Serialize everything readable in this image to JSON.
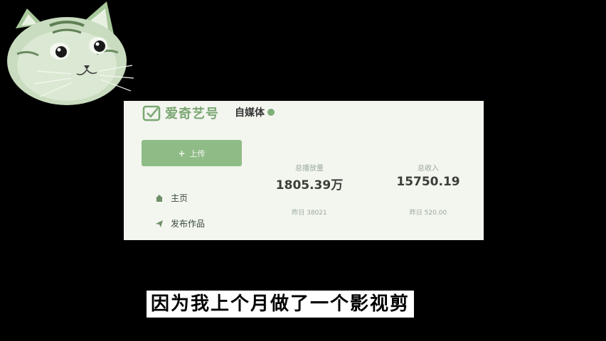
{
  "brand": {
    "name": "爱奇艺号"
  },
  "account": {
    "type_label": "自媒体"
  },
  "sidebar": {
    "upload_label": "上传",
    "items": [
      {
        "label": "主页",
        "icon": "home-icon"
      },
      {
        "label": "发布作品",
        "icon": "send-icon"
      }
    ]
  },
  "stats": {
    "views": {
      "label": "总播放量",
      "value": "1805.39万",
      "yesterday": "昨日 38021"
    },
    "income": {
      "label": "总收入",
      "value": "15750.19",
      "yesterday": "昨日 520.00"
    }
  },
  "subtitle": {
    "text": "因为我上个月做了一个影视剪"
  },
  "colors": {
    "accent": "#8fbc86",
    "panel_bg": "#f3f5ef",
    "page_bg": "#000000"
  }
}
